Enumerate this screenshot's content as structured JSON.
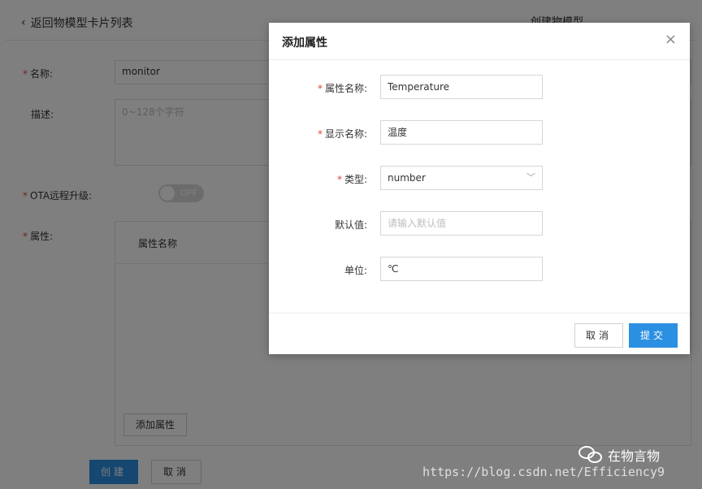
{
  "background_page": {
    "back_link": "返回物模型卡片列表",
    "header_right": "创建物模型",
    "name_label": "名称:",
    "name_value": "monitor",
    "desc_label": "描述:",
    "desc_placeholder": "0~128个字符",
    "ota_label": "OTA远程升级:",
    "ota_toggle": "OFF",
    "attr_label": "属性:",
    "attr_column": "属性名称",
    "add_attr_button": "添加属性",
    "create_button": "创建",
    "cancel_button": "取消"
  },
  "modal": {
    "title": "添加属性",
    "close": "×",
    "fields": {
      "attr_name_label": "属性名称:",
      "attr_name_value": "Temperature",
      "display_name_label": "显示名称:",
      "display_name_value": "温度",
      "type_label": "类型:",
      "type_value": "number",
      "default_label": "默认值:",
      "default_placeholder": "请输入默认值",
      "unit_label": "单位:",
      "unit_value": "℃"
    },
    "cancel_button": "取消",
    "submit_button": "提交"
  },
  "watermark": {
    "brand": "在物言物",
    "url": "https://blog.csdn.net/Efficiency9"
  },
  "colors": {
    "primary": "#2b8fe2",
    "required": "#e0443b",
    "overlay": "rgba(0,0,0,0.5)"
  }
}
